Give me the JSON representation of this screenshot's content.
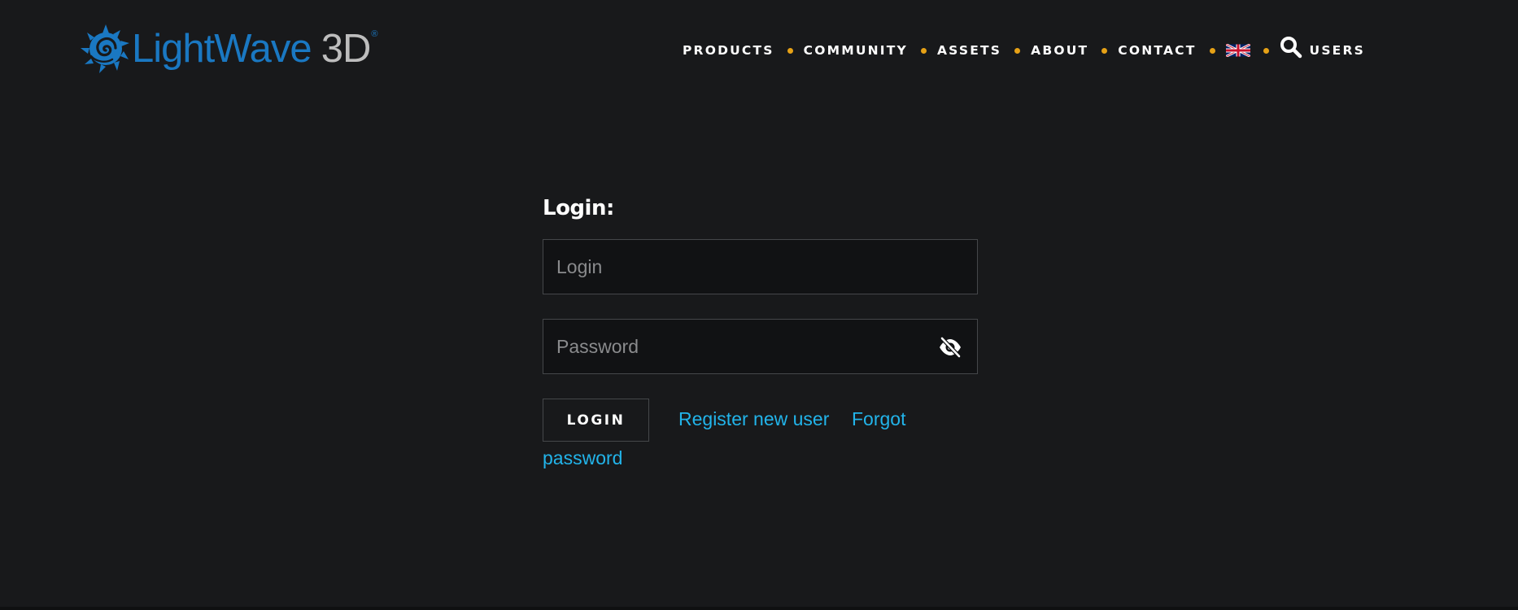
{
  "header": {
    "logo": {
      "word": "LightWave",
      "suffix": "3D",
      "registered": "®",
      "icon": "lightwave-swirl-logo"
    },
    "nav": {
      "items": [
        {
          "label": "PRODUCTS"
        },
        {
          "label": "COMMUNITY"
        },
        {
          "label": "ASSETS"
        },
        {
          "label": "ABOUT"
        },
        {
          "label": "CONTACT"
        }
      ],
      "language_icon": "uk-flag-icon",
      "search_icon": "search-icon",
      "users_label": "USERS"
    }
  },
  "login_form": {
    "title": "Login:",
    "login_field": {
      "value": "",
      "placeholder": "Login"
    },
    "password_field": {
      "value": "",
      "placeholder": "Password",
      "toggle_icon": "eye-slash-icon"
    },
    "login_button": "LOGIN",
    "register_link": "Register new user",
    "forgot_link_line1": "Forgot",
    "forgot_link_line2": "password"
  },
  "colors": {
    "background": "#18191b",
    "field_background": "#111214",
    "border": "#45474a",
    "accent_link": "#22b4ea",
    "nav_separator": "#e6a116",
    "logo_blue": "#1a78c2",
    "logo_grey": "#bdbdbd"
  }
}
